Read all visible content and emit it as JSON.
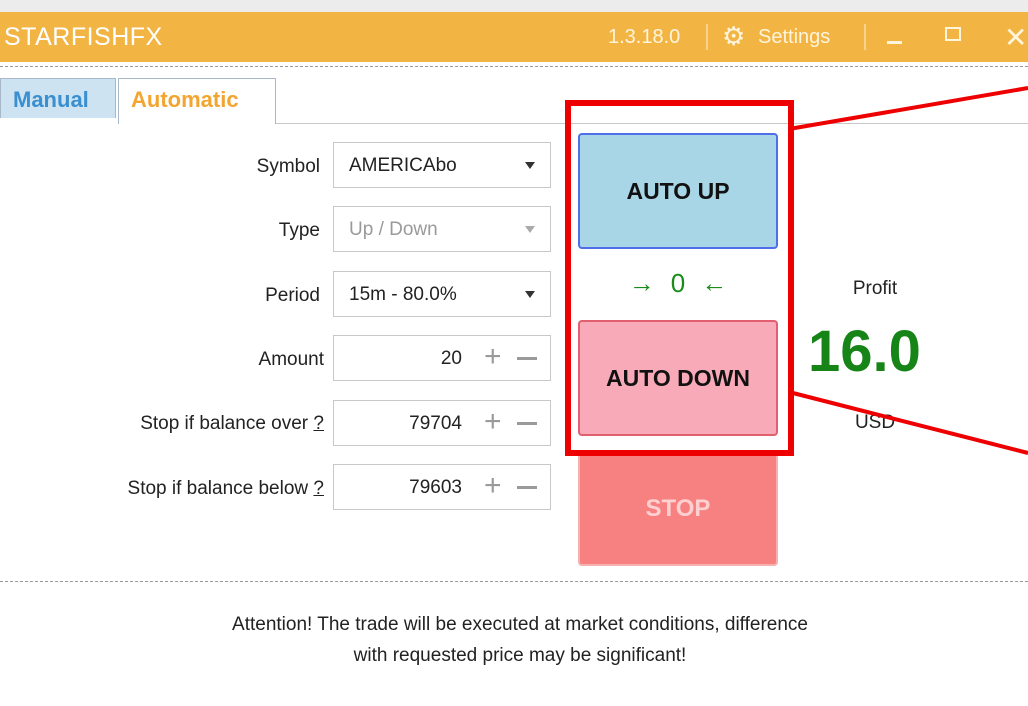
{
  "window": {
    "title": "STARFISHFX",
    "version": "1.3.18.0",
    "settings_label": "Settings"
  },
  "tabs": [
    {
      "label": "Manual",
      "active": false
    },
    {
      "label": "Automatic",
      "active": true
    }
  ],
  "form": {
    "symbol": {
      "label": "Symbol",
      "value": "AMERICAbo"
    },
    "type": {
      "label": "Type",
      "value": "Up / Down",
      "disabled": true
    },
    "period": {
      "label": "Period",
      "value": "15m - 80.0%"
    },
    "amount": {
      "label": "Amount",
      "value": "20"
    },
    "stop_over": {
      "label": "Stop if balance over",
      "help": "?",
      "value": "79704"
    },
    "stop_below": {
      "label": "Stop if balance below",
      "help": "?",
      "value": "79603"
    }
  },
  "buttons": {
    "auto_up": "AUTO UP",
    "auto_down": "AUTO DOWN",
    "stop": "STOP"
  },
  "counter": {
    "left_arrow": "→",
    "value": "0",
    "right_arrow": "←"
  },
  "profit": {
    "label": "Profit",
    "value": "16.0",
    "unit": "USD"
  },
  "attention": {
    "line1": "Attention! The trade will be executed at market conditions, difference",
    "line2": "with requested price may be significant!"
  },
  "colors": {
    "titlebar": "#f2b544",
    "auto_up": "#a9d6e6",
    "auto_down": "#f8aab8",
    "stop": "#f78181",
    "profit": "#178417",
    "highlight": "#ee0000"
  },
  "icons": [
    "gear-icon",
    "minimize-icon",
    "maximize-icon",
    "close-icon",
    "chevron-down-icon",
    "plus-icon",
    "minus-icon"
  ]
}
